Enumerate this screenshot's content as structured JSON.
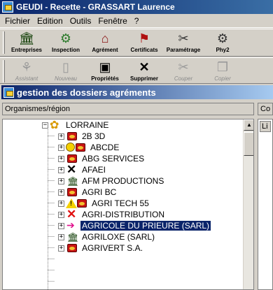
{
  "window": {
    "title": "GEUDI - Recette - GRASSART Laurence",
    "app_icon": "geudi-app-icon"
  },
  "menu": [
    "Fichier",
    "Edition",
    "Outils",
    "Fenêtre",
    "?"
  ],
  "toolbar1": [
    {
      "label": "Entreprises",
      "icon": "bank-icon"
    },
    {
      "label": "Inspection",
      "icon": "inspection-icon"
    },
    {
      "label": "Agrément",
      "icon": "agrement-icon"
    },
    {
      "label": "Certificats",
      "icon": "certificate-icon"
    },
    {
      "label": "Paramétrage",
      "icon": "settings-icon"
    },
    {
      "label": "Phy2",
      "icon": "phy-icon"
    }
  ],
  "toolbar2": [
    {
      "label": "Assistant",
      "icon": "wizard-icon",
      "enabled": false
    },
    {
      "label": "Nouveau",
      "icon": "new-document-icon",
      "enabled": false
    },
    {
      "label": "Propriétés",
      "icon": "properties-icon",
      "enabled": true
    },
    {
      "label": "Supprimer",
      "icon": "delete-icon",
      "enabled": true
    },
    {
      "label": "Couper",
      "icon": "cut-icon",
      "enabled": false
    },
    {
      "label": "Copier",
      "icon": "copy-icon",
      "enabled": false
    }
  ],
  "subwindow": {
    "title": "gestion des dossiers agréments"
  },
  "panel": {
    "left_header": "Organismes/région",
    "right_header": "Co",
    "right_list_header": "Li"
  },
  "tree": {
    "root": {
      "label": "LORRAINE",
      "icon": "region-icon",
      "expander": "−"
    },
    "items": [
      {
        "label": "2B 3D",
        "icon": "factory-icon"
      },
      {
        "label": "ABCDE",
        "icon": "smiley-factory-icon"
      },
      {
        "label": "ABG SERVICES",
        "icon": "factory-icon"
      },
      {
        "label": "AFAEI",
        "icon": "black-x-icon"
      },
      {
        "label": "AFM PRODUCTIONS",
        "icon": "bank-icon"
      },
      {
        "label": "AGRI BC",
        "icon": "factory-icon"
      },
      {
        "label": "AGRI TECH 55",
        "icon": "warning-factory-icon"
      },
      {
        "label": "AGRI-DISTRIBUTION",
        "icon": "red-x-icon"
      },
      {
        "label": "AGRICOLE DU PRIEURE (SARL)",
        "icon": "arrow-right-icon",
        "selected": true
      },
      {
        "label": "AGRILOXE (SARL)",
        "icon": "bank-icon"
      },
      {
        "label": "AGRIVERT S.A.",
        "icon": "factory-icon"
      }
    ],
    "expander_collapsed": "+"
  },
  "colors": {
    "title_bar": "#0a246a",
    "selection": "#0a246a",
    "face": "#d4d0c8"
  }
}
